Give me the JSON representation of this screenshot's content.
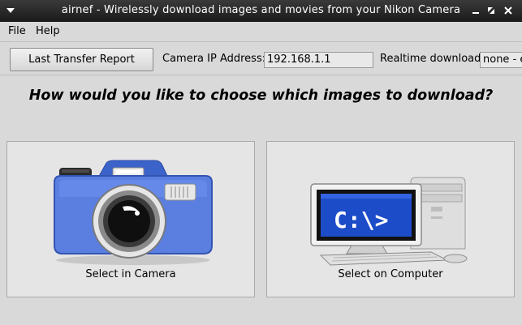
{
  "window": {
    "title": "airnef - Wirelessly download images and movies from your Nikon Camera"
  },
  "menu": {
    "items": [
      "File",
      "Help"
    ]
  },
  "toolbar": {
    "report_button": "Last Transfer Report",
    "ip_label": "Camera IP Address:",
    "ip_value": "192.168.1.1",
    "realtime_label": "Realtime download:",
    "realtime_value": "none - e"
  },
  "main": {
    "question": "How would you like to choose which images to download?",
    "camera_button": "Select in Camera",
    "computer_button": "Select on Computer",
    "prompt_text": "C:\\>"
  }
}
